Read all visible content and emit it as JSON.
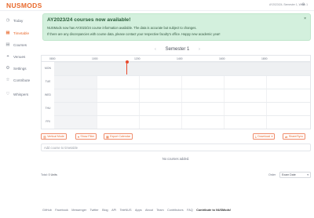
{
  "app": {
    "logo": "NUSMODS",
    "semester_info": "AY2023/24, Semester 1, Week 1",
    "settings_icon": "gear-icon"
  },
  "sidebar": {
    "items": [
      {
        "label": "Today",
        "icon": "clock-icon",
        "active": false
      },
      {
        "label": "Timetable",
        "icon": "calendar-icon",
        "active": true
      },
      {
        "label": "Courses",
        "icon": "book-icon",
        "active": false
      },
      {
        "label": "Venues",
        "icon": "map-icon",
        "active": false
      },
      {
        "label": "Settings",
        "icon": "gear-icon",
        "active": false
      },
      {
        "label": "Contribute",
        "icon": "star-icon",
        "active": false
      },
      {
        "label": "Whispers",
        "icon": "heart-icon",
        "active": false
      }
    ]
  },
  "banner": {
    "title": "AY2023/24 courses now available!",
    "line1": "NUSMods now has AY2023/24 course information available. The data is accurate but subject to changes.",
    "line2": "If there are any discrepancies with course data, please contact your respective faculty's office. Happy new academic year!",
    "close": "×"
  },
  "semester": {
    "label": "Semester 1",
    "prev": "‹",
    "next": "›"
  },
  "timetable": {
    "hours": [
      "0800",
      "1000",
      "1200",
      "1400",
      "1600",
      "1800"
    ],
    "days": [
      "MON",
      "TUE",
      "WED",
      "THU",
      "FRI"
    ]
  },
  "toolbar": {
    "buttons": [
      {
        "label": "Vertical Mode",
        "icon": "columns-icon"
      },
      {
        "label": "Show Filter",
        "icon": "filter-icon"
      },
      {
        "label": "Export Calendar",
        "icon": "calendar-icon"
      },
      {
        "label": "Download",
        "icon": "download-icon"
      },
      {
        "label": "Share/Sync",
        "icon": "share-icon"
      }
    ]
  },
  "add_course": {
    "placeholder": "Add course to timetable"
  },
  "no_courses": "No courses added.",
  "summary": {
    "total_label": "Total:",
    "units": "0 Units"
  },
  "order": {
    "label": "Order",
    "value": "Exam Date"
  },
  "footer": {
    "links": [
      "GitHub",
      "Facebook",
      "Messenger",
      "Twitter",
      "Blog",
      "API",
      "TeleNUS",
      "Apps",
      "About",
      "Team",
      "Contributors",
      "FAQ"
    ],
    "strong": "Contribute to NUSMods!"
  }
}
